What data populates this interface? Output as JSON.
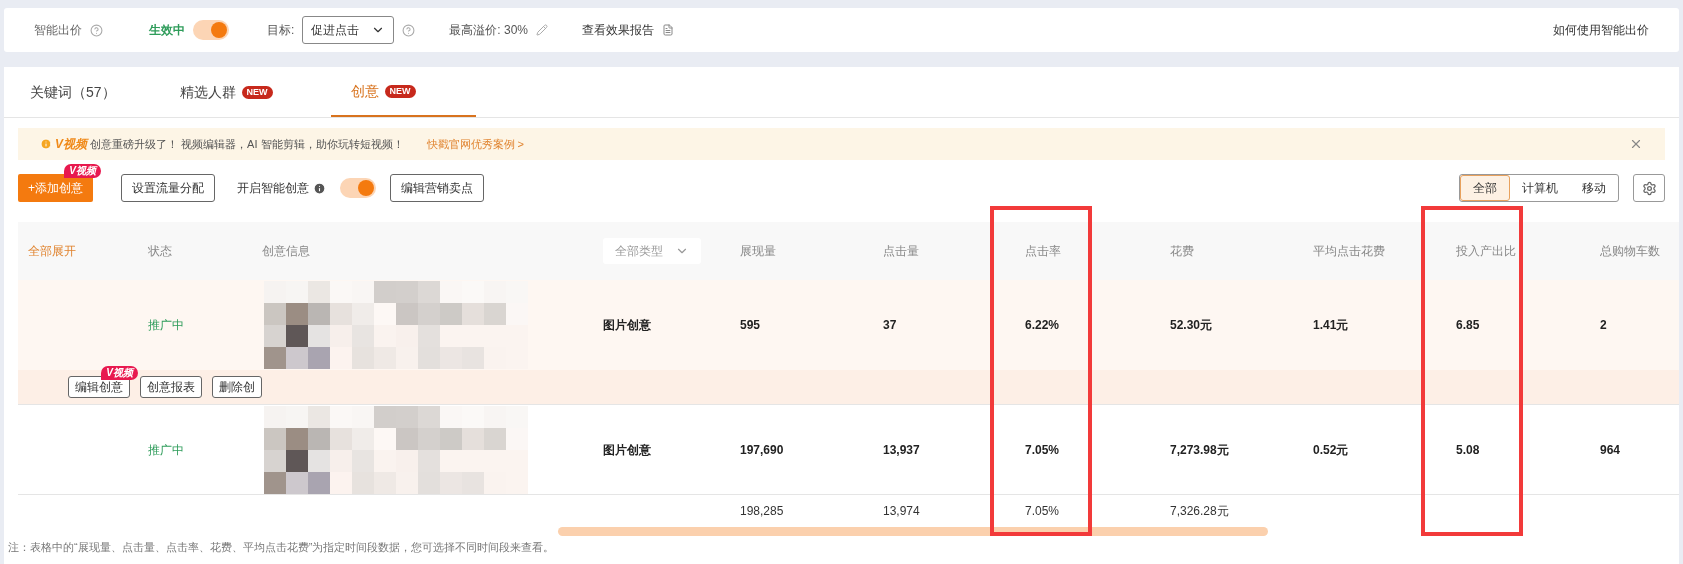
{
  "top_bar": {
    "label": "智能出价",
    "status": "生效中",
    "enabled": true,
    "goal_label": "目标:",
    "goal_value": "促进点击",
    "max_premium": "最高溢价: 30%",
    "report_link": "查看效果报告",
    "help_link": "如何使用智能出价"
  },
  "tabs": [
    {
      "label": "关键词（57）",
      "selected": false
    },
    {
      "label": "精选人群",
      "badge": "NEW",
      "selected": false
    },
    {
      "label": "创意",
      "badge": "NEW",
      "selected": true
    }
  ],
  "notice": {
    "badge": "V视频",
    "text": "创意重磅升级了！ 视频编辑器，AI 智能剪辑，助你玩转短视频！",
    "link": "快戳官网优秀案例 >"
  },
  "toolbar": {
    "add_button": "+添加创意",
    "add_badge": "V视频",
    "traffic_button": "设置流量分配",
    "smart_label": "开启智能创意",
    "smart_on": true,
    "selling_button": "编辑营销卖点",
    "device_tabs": [
      {
        "label": "全部",
        "selected": true
      },
      {
        "label": "计算机",
        "selected": false
      },
      {
        "label": "移动",
        "selected": false
      }
    ]
  },
  "table": {
    "columns": [
      {
        "label": "全部展开",
        "kind": "link"
      },
      {
        "label": "状态",
        "kind": "text"
      },
      {
        "label": "创意信息",
        "kind": "text"
      },
      {
        "label": "全部类型",
        "kind": "dropdown"
      },
      {
        "label": "展现量",
        "kind": "text"
      },
      {
        "label": "点击量",
        "kind": "text"
      },
      {
        "label": "点击率",
        "kind": "text",
        "highlighted": true
      },
      {
        "label": "花费",
        "kind": "text"
      },
      {
        "label": "平均点击花费",
        "kind": "text"
      },
      {
        "label": "投入产出比",
        "kind": "text",
        "highlighted": true
      },
      {
        "label": "总购物车数",
        "kind": "text"
      }
    ],
    "rows": [
      {
        "cells": [
          "",
          "推广中",
          "",
          "图片创意",
          "595",
          "37",
          "6.22%",
          "52.30元",
          "1.41元",
          "6.85",
          "2"
        ],
        "expanded": true,
        "actions": [
          {
            "label": "编辑创意",
            "badge": "V视频"
          },
          {
            "label": "创意报表"
          },
          {
            "label": "删除创"
          }
        ]
      },
      {
        "cells": [
          "",
          "推广中",
          "",
          "图片创意",
          "197,690",
          "13,937",
          "7.05%",
          "7,273.98元",
          "0.52元",
          "5.08",
          "964"
        ],
        "expanded": false
      }
    ],
    "totals": [
      "198,285",
      "13,974",
      "7.05%",
      "7,326.28元"
    ]
  },
  "note": "注：表格中的“展现量、点击量、点击率、花费、平均点击花费”为指定时间段数据，您可选择不同时间段来查看。"
}
